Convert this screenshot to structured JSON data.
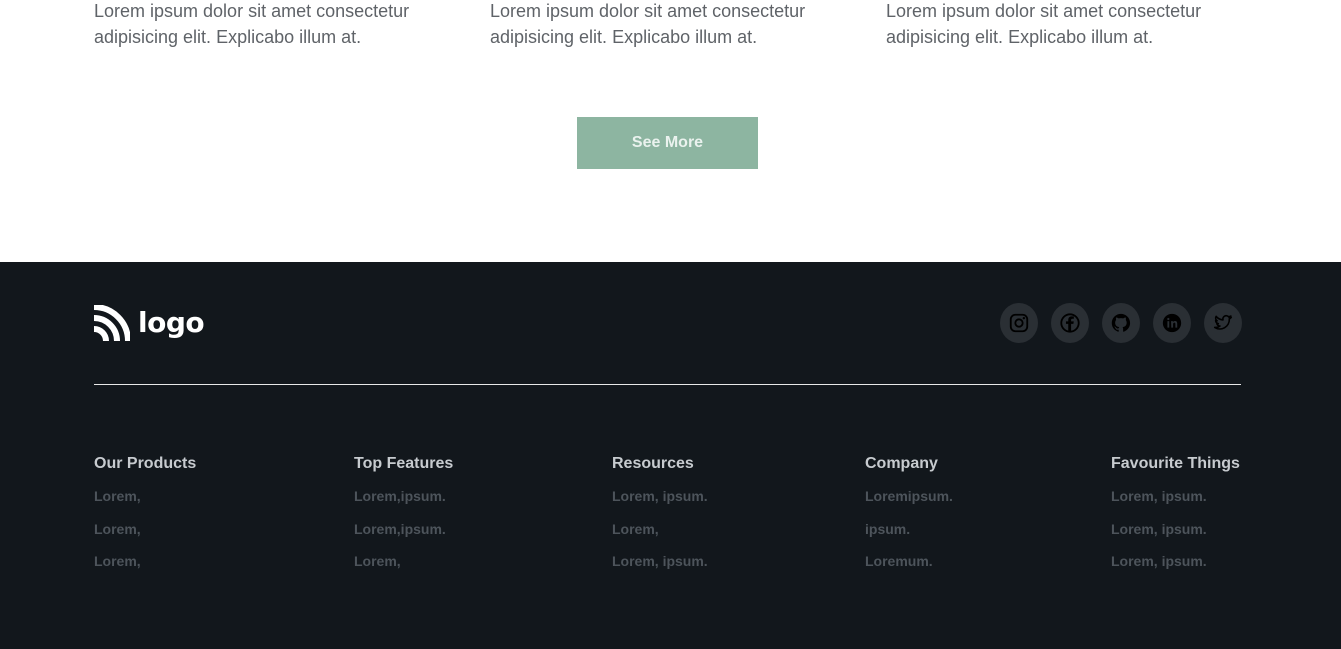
{
  "cards": [
    {
      "text": "Lorem ipsum dolor sit amet consectetur adipisicing elit. Explicabo illum at."
    },
    {
      "text": "Lorem ipsum dolor sit amet consectetur adipisicing elit. Explicabo illum at."
    },
    {
      "text": "Lorem ipsum dolor sit amet consectetur adipisicing elit. Explicabo illum at."
    }
  ],
  "see_more": {
    "label": "See More",
    "color": "#8db5a1"
  },
  "footer": {
    "background": "#12171c",
    "logo": {
      "text": "logo",
      "icon": "rss-feed-icon"
    },
    "socials": [
      {
        "icon": "instagram-icon"
      },
      {
        "icon": "facebook-icon"
      },
      {
        "icon": "github-icon"
      },
      {
        "icon": "linkedin-icon"
      },
      {
        "icon": "twitter-icon"
      }
    ],
    "columns": [
      {
        "title": "Our Products",
        "links": [
          "Lorem,",
          "Lorem,",
          "Lorem,"
        ]
      },
      {
        "title": "Top Features",
        "links": [
          "Lorem,ipsum.",
          "Lorem,ipsum.",
          "Lorem,"
        ]
      },
      {
        "title": "Resources",
        "links": [
          "Lorem, ipsum.",
          "Lorem,",
          "Lorem, ipsum."
        ]
      },
      {
        "title": "Company",
        "links": [
          "Loremipsum.",
          "ipsum.",
          "Loremum."
        ]
      },
      {
        "title": "Favourite Things",
        "links": [
          "Lorem, ipsum.",
          "Lorem, ipsum.",
          "Lorem, ipsum."
        ]
      }
    ]
  }
}
